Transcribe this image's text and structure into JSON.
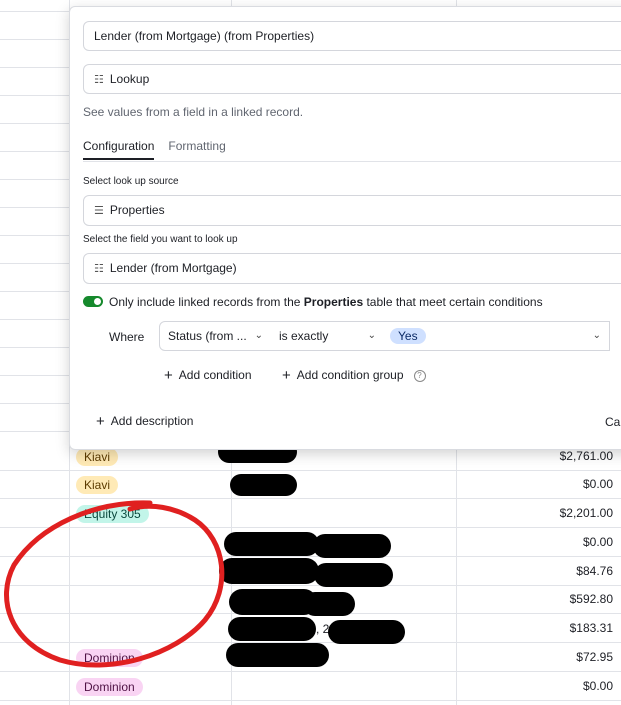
{
  "dialog": {
    "field_name": "Lender (from Mortgage) (from Properties)",
    "field_type": "Lookup",
    "description": "See values from a field in a linked record.",
    "tabs": [
      "Configuration",
      "Formatting"
    ],
    "source_label": "Select look up source",
    "source_value": "Properties",
    "lookup_label": "Select the field you want to look up",
    "lookup_value": "Lender (from Mortgage)",
    "condition_prefix": "Only include linked records from the",
    "condition_table": "Properties",
    "condition_suffix": "table that meet certain conditions",
    "where_label": "Where",
    "filter_field": "Status (from ...",
    "filter_op": "is exactly",
    "filter_value": "Yes",
    "add_condition": "Add condition",
    "add_condition_group": "Add condition group",
    "add_description": "Add description",
    "cancel_partial": "Car"
  },
  "rows": [
    {
      "lender": "Kiavi",
      "amount": "$2,761.00",
      "tag": "kiavi"
    },
    {
      "lender": "Kiavi",
      "amount": "$0.00",
      "tag": "kiavi"
    },
    {
      "lender": "Equity 305",
      "amount": "$2,201.00",
      "tag": "equity"
    },
    {
      "lender": "",
      "amount": "$0.00",
      "tag": ""
    },
    {
      "lender": "",
      "amount": "$84.76",
      "tag": ""
    },
    {
      "lender": "",
      "amount": "$592.80",
      "tag": ""
    },
    {
      "lender": "",
      "amount": "$183.31",
      "tag": ""
    },
    {
      "lender": "Dominion",
      "amount": "$72.95",
      "tag": "dominion"
    },
    {
      "lender": "Dominion",
      "amount": "$0.00",
      "tag": "dominion"
    }
  ],
  "partial_text": ", 2",
  "colors": {
    "toggle_on": "#15892c",
    "annotation": "#e02020"
  }
}
